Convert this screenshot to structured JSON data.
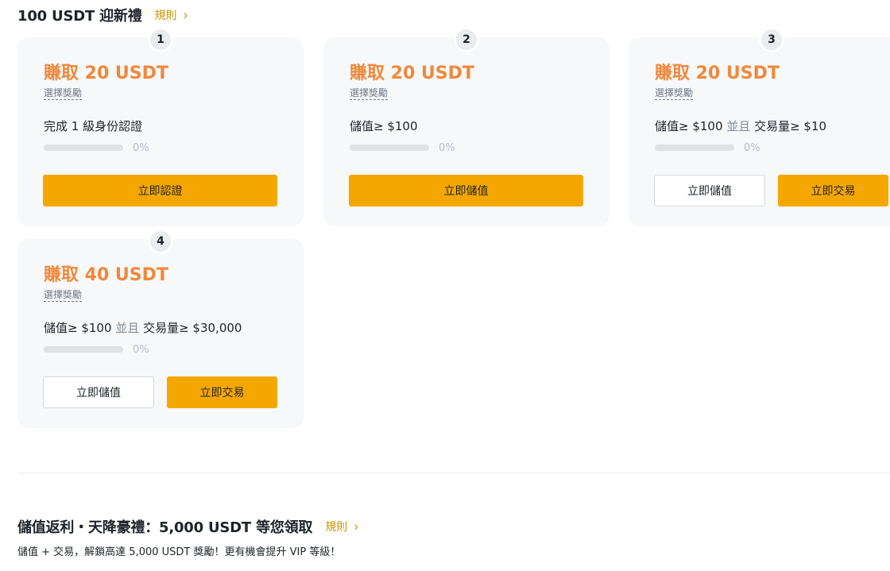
{
  "section1": {
    "title": "100 USDT 迎新禮",
    "rules_label": "規則"
  },
  "cards": [
    {
      "step": "1",
      "reward": "賺取 20 USDT",
      "choose_label": "選擇獎勵",
      "condition": "完成 1 級身份認證",
      "progress": 0,
      "progress_text": "0%",
      "button": "立即認證"
    },
    {
      "step": "2",
      "reward": "賺取 20 USDT",
      "choose_label": "選擇獎勵",
      "condition": "儲值≥ $100",
      "progress": 0,
      "progress_text": "0%",
      "button": "立即儲值"
    },
    {
      "step": "3",
      "reward": "賺取 20 USDT",
      "choose_label": "選擇獎勵",
      "condition_a": "儲值≥ $100",
      "conjunction": "並且",
      "condition_b": "交易量≥ $10",
      "progress": 0,
      "progress_text": "0%",
      "button_secondary": "立即儲值",
      "button_primary": "立即交易"
    },
    {
      "step": "4",
      "reward": "賺取 40 USDT",
      "choose_label": "選擇獎勵",
      "condition_a": "儲值≥ $100",
      "conjunction": "並且",
      "condition_b": "交易量≥ $30,000",
      "progress": 0,
      "progress_text": "0%",
      "button_secondary": "立即儲值",
      "button_primary": "立即交易"
    }
  ],
  "section2": {
    "title": "儲值返利・天降豪禮：5,000 USDT 等您領取",
    "rules_label": "規則",
    "description": "儲值 + 交易，解鎖高達 5,000 USDT 獎勵！更有機會提升 VIP 等級！"
  },
  "colors": {
    "accent_orange": "#f0883a",
    "button_yellow": "#f5a700",
    "link_gold": "#c99400"
  }
}
